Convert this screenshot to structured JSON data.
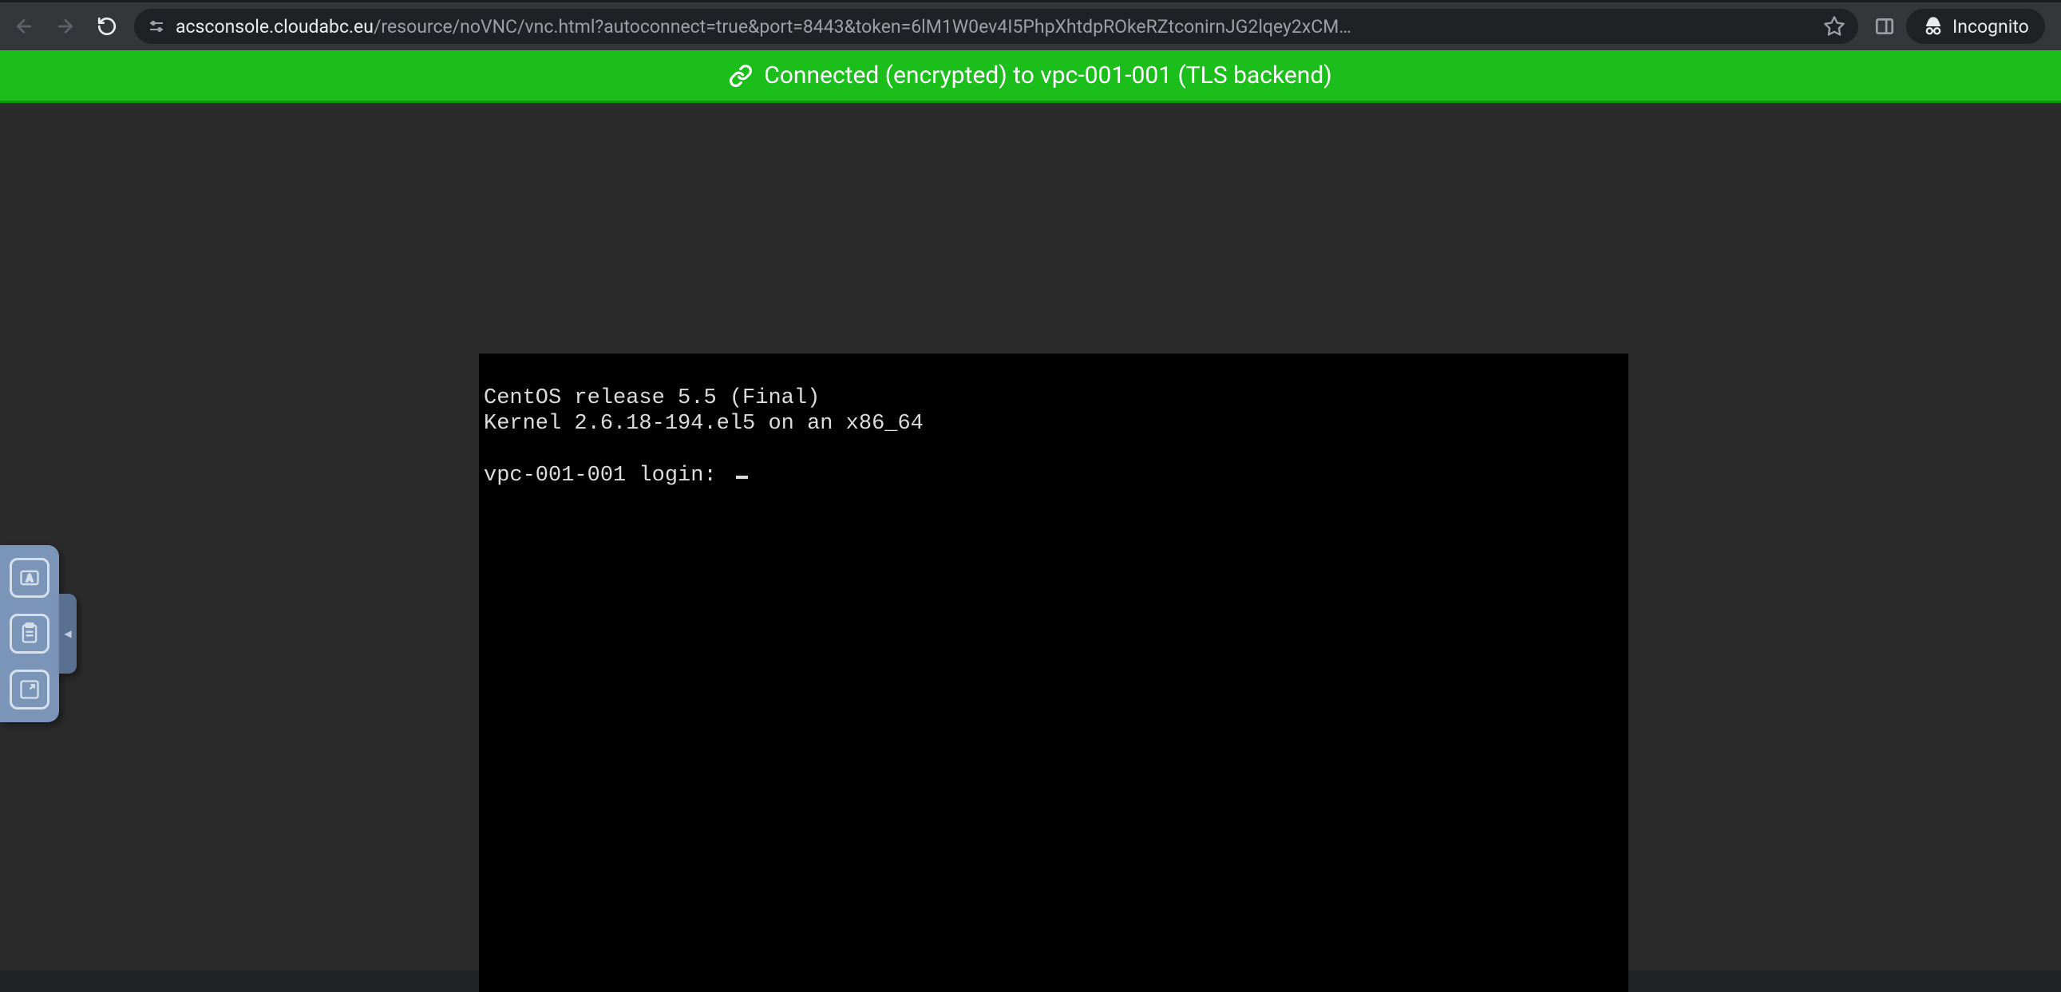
{
  "browser": {
    "url_domain": "acsconsole.cloudabc.eu",
    "url_path": "/resource/noVNC/vnc.html?autoconnect=true&port=8443&token=6lM1W0ev4I5PhpXhtdpROkeRZtconirnJG2lqey2xCM…",
    "incognito_label": "Incognito"
  },
  "status": {
    "message": "Connected (encrypted) to vpc-001-001 (TLS backend)"
  },
  "console": {
    "line1": "CentOS release 5.5 (Final)",
    "line2": "Kernel 2.6.18-194.el5 on an x86_64",
    "login_prompt": "vpc-001-001 login: "
  },
  "icons": {
    "back": "back-arrow",
    "forward": "forward-arrow",
    "reload": "reload",
    "site_info": "tune",
    "star": "star-outline",
    "panel": "side-panel",
    "incognito": "incognito-hat",
    "link": "chain-link",
    "keyboard": "keyboard-a",
    "clipboard": "clipboard",
    "fullscreen": "fullscreen"
  }
}
